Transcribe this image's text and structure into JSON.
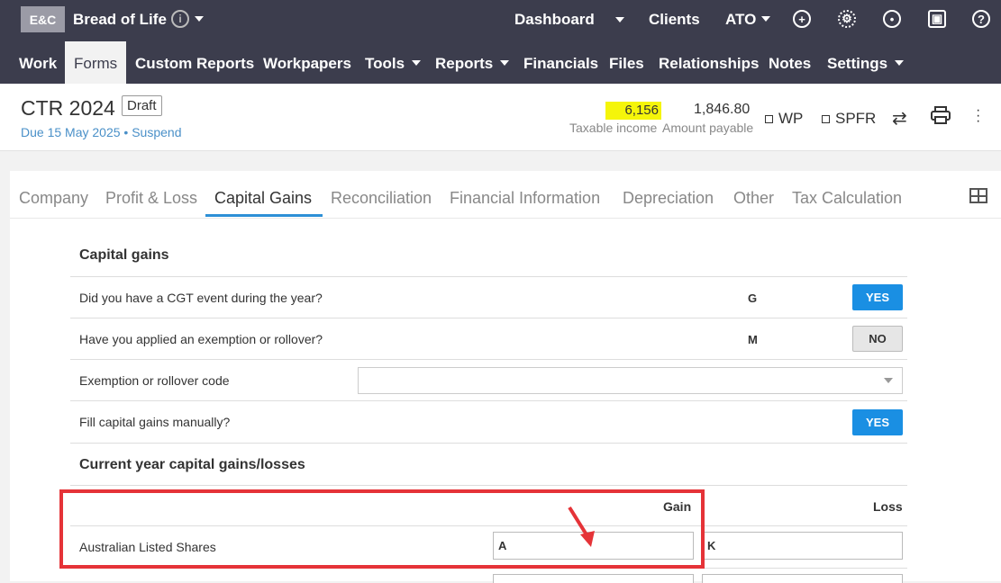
{
  "topbar": {
    "logo": "E&C",
    "client_name": "Bread of Life",
    "info_icon_text": "i",
    "links": [
      "Dashboard",
      "Clients",
      "ATO"
    ],
    "icons": [
      "plus-circle-icon",
      "gear-icon",
      "user-circle-icon",
      "gift-icon",
      "help-icon"
    ]
  },
  "nav": {
    "items": [
      "Work",
      "Forms",
      "Custom Reports",
      "Workpapers",
      "Tools",
      "Reports",
      "Financials",
      "Files",
      "Relationships",
      "Notes",
      "Settings"
    ],
    "active": "Forms"
  },
  "header": {
    "title": "CTR 2024",
    "status": "Draft",
    "due_prefix": "Due",
    "due_date": "15 May 2025",
    "separator": "•",
    "suspend": "Suspend",
    "taxable_income": "6,156",
    "taxable_label": "Taxable income",
    "amount_payable": "1,846.80",
    "payable_label": "Amount payable",
    "check_wp": "WP",
    "check_spfr": "SPFR",
    "highlight_color": "#f5f50a"
  },
  "tabs": [
    "Company",
    "Profit & Loss",
    "Capital Gains",
    "Reconciliation",
    "Financial Information",
    "Depreciation",
    "Other",
    "Tax Calculation"
  ],
  "active_tab": "Capital Gains",
  "capital_gains": {
    "title": "Capital gains",
    "rows": [
      {
        "label": "Did you have a CGT event during the year?",
        "code": "G",
        "value": "YES"
      },
      {
        "label": "Have you applied an exemption or rollover?",
        "code": "M",
        "value": "NO"
      },
      {
        "label": "Exemption or rollover code",
        "value": ""
      },
      {
        "label": "Fill capital gains manually?",
        "value": "YES"
      }
    ]
  },
  "current_year": {
    "title": "Current year capital gains/losses",
    "col_gain": "Gain",
    "col_loss": "Loss",
    "rows": [
      {
        "label": "Australian Listed Shares",
        "gain_code": "A",
        "loss_code": "K"
      }
    ]
  },
  "annotation": {
    "color": "#e53338"
  }
}
